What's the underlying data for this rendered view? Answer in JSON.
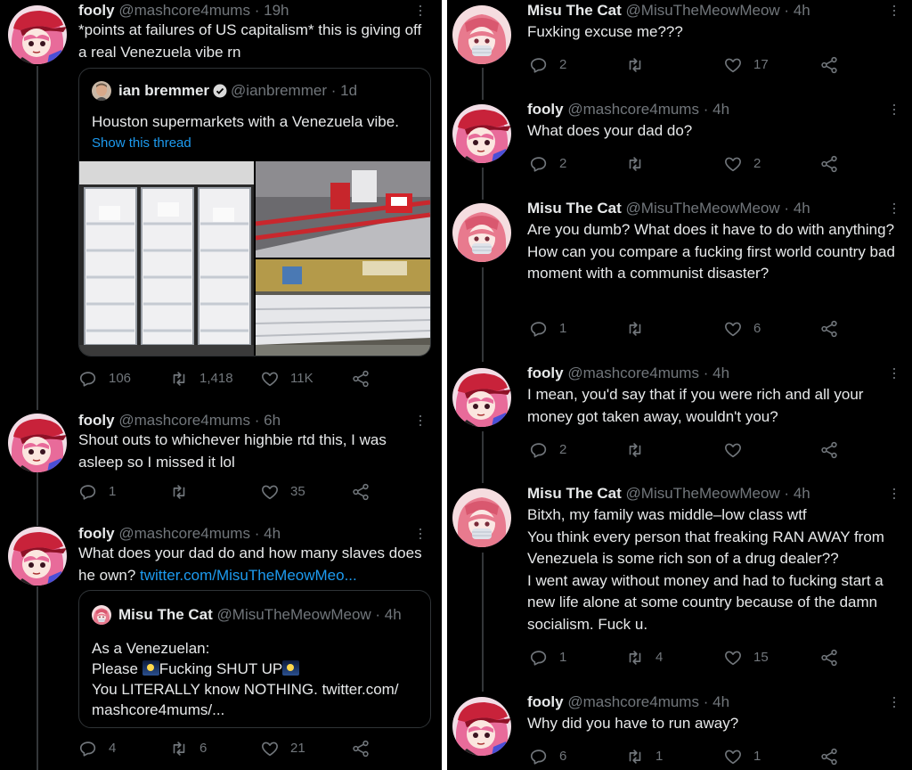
{
  "icons": {
    "reply": "reply-icon",
    "retweet": "retweet-icon",
    "like": "like-icon",
    "share": "share-icon",
    "more": "more-icon",
    "verified": "verified-badge-icon"
  },
  "colors": {
    "background": "#000000",
    "text": "#e7e9ea",
    "secondary": "#71767b",
    "link": "#1d9bf0",
    "divider": "#ffffff",
    "border": "#2f3336"
  },
  "left": {
    "t1": {
      "name": "fooly",
      "handle": "@mashcore4mums",
      "time": "19h",
      "text": "*points at failures of US capitalism* this is giving off a real Venezuela vibe rn",
      "quote": {
        "name": "ian bremmer",
        "handle": "@ianbremmer",
        "time": "1d",
        "text": "Houston supermarkets with a Venezuela vibe.",
        "show_thread": "Show this thread",
        "images": [
          "Empty freezer aisle",
          "Empty supermarket shelves",
          "Empty refrigerated cases"
        ]
      },
      "replies": "106",
      "retweets": "1,418",
      "likes": "11K"
    },
    "t2": {
      "name": "fooly",
      "handle": "@mashcore4mums",
      "time": "6h",
      "text": "Shout outs to whichever highbie rtd this, I was asleep so I missed it lol",
      "replies": "1",
      "retweets": "",
      "likes": "35"
    },
    "t3": {
      "name": "fooly",
      "handle": "@mashcore4mums",
      "time": "4h",
      "text": "What does your dad do and how many slaves does he own?",
      "link": "twitter.com/MisuTheMeowMeo...",
      "quote": {
        "name": "Misu The Cat",
        "handle": "@MisuTheMeowMeow",
        "time": "4h",
        "line1": "As a Venezuelan:",
        "line2a": "Please ",
        "line2b": "Fucking SHUT UP",
        "line3": "You LITERALLY know NOTHING. twitter.com/",
        "line4": "mashcore4mums/..."
      },
      "replies": "4",
      "retweets": "6",
      "likes": "21"
    }
  },
  "right": {
    "r1": {
      "name": "Misu The Cat",
      "handle": "@MisuTheMeowMeow",
      "time": "4h",
      "text": "Fuxking excuse me???",
      "replies": "2",
      "retweets": "",
      "likes": "17"
    },
    "r2": {
      "name": "fooly",
      "handle": "@mashcore4mums",
      "time": "4h",
      "text": "What does your dad do?",
      "replies": "2",
      "retweets": "",
      "likes": "2"
    },
    "r3": {
      "name": "Misu The Cat",
      "handle": "@MisuTheMeowMeow",
      "time": "4h",
      "text": "Are you dumb? What does it have to do with anything?\nHow can you compare a fucking first world country bad moment with a communist disaster?",
      "replies": "1",
      "retweets": "",
      "likes": "6"
    },
    "r4": {
      "name": "fooly",
      "handle": "@mashcore4mums",
      "time": "4h",
      "text": "I mean, you'd say that if you were rich and all your money got taken away, wouldn't you?",
      "replies": "2",
      "retweets": "",
      "likes": ""
    },
    "r5": {
      "name": "Misu The Cat",
      "handle": "@MisuTheMeowMeow",
      "time": "4h",
      "text": "Bitxh, my family was middle–low class wtf\nYou think every person that freaking RAN AWAY from Venezuela is some rich son of a drug dealer??\nI went away without money and had to fucking start a new life alone at some country because of the damn socialism. Fuck u.",
      "replies": "1",
      "retweets": "4",
      "likes": "15"
    },
    "r6": {
      "name": "fooly",
      "handle": "@mashcore4mums",
      "time": "4h",
      "text": "Why did you have to run away?",
      "replies": "6",
      "retweets": "1",
      "likes": "1"
    }
  }
}
